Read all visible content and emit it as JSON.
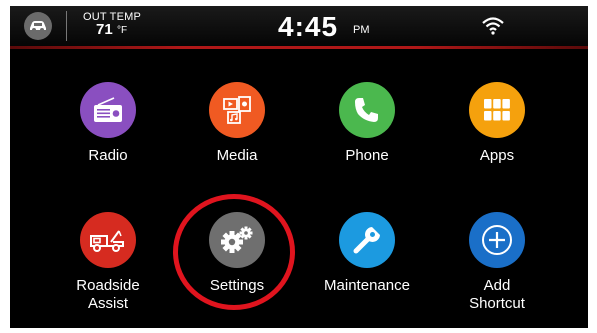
{
  "status": {
    "temp_label": "OUT TEMP",
    "temp_value": "71",
    "temp_unit": "°F",
    "time": "4:45",
    "ampm": "PM"
  },
  "apps": {
    "radio": {
      "label": "Radio",
      "color": "#8a4fc0"
    },
    "media": {
      "label": "Media",
      "color": "#f05a22"
    },
    "phone": {
      "label": "Phone",
      "color": "#4bb84e"
    },
    "apps": {
      "label": "Apps",
      "color": "#f5a10d"
    },
    "roadside": {
      "label_line1": "Roadside",
      "label_line2": "Assist",
      "color": "#d62b20"
    },
    "settings": {
      "label": "Settings",
      "color": "#6f6f6f"
    },
    "maintenance": {
      "label": "Maintenance",
      "color": "#1c9ae0"
    },
    "add_shortcut": {
      "label_line1": "Add",
      "label_line2": "Shortcut",
      "color": "#1a6fc8"
    }
  },
  "highlight_color": "#e0141e",
  "icons": [
    "car-icon",
    "wifi-icon",
    "radio-icon",
    "media-icon",
    "phone-icon",
    "apps-grid-icon",
    "tow-truck-icon",
    "gears-icon",
    "wrench-icon",
    "plus-icon"
  ]
}
